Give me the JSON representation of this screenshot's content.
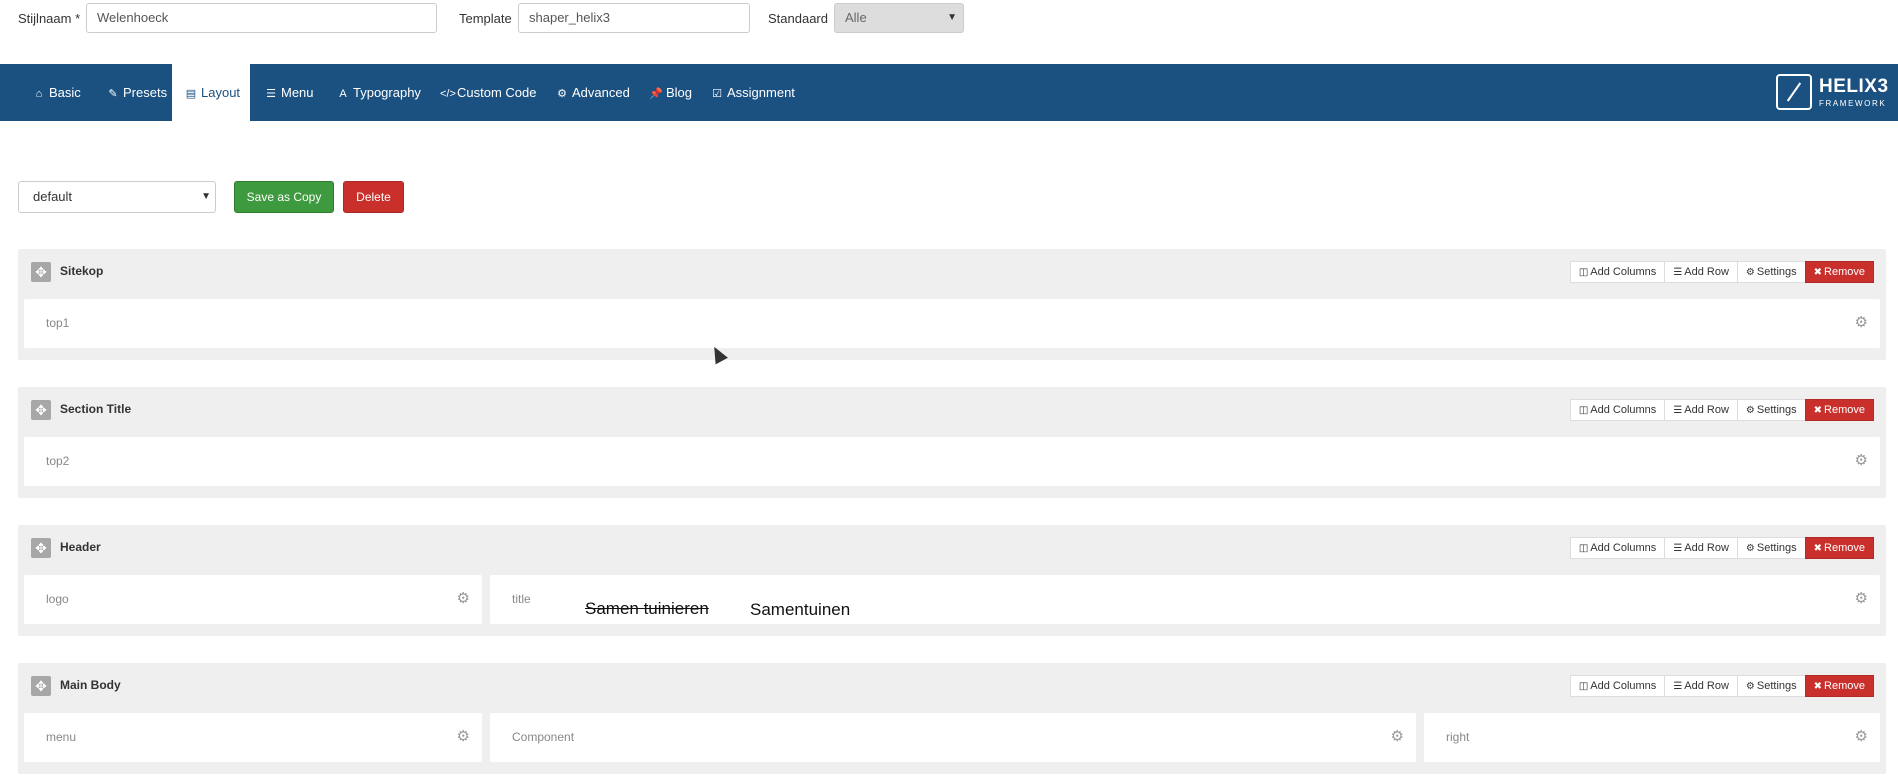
{
  "form": {
    "style_name_label": "Stijlnaam *",
    "style_name_value": "Welenhoeck",
    "template_label": "Template",
    "template_value": "shaper_helix3",
    "default_label": "Standaard",
    "default_value": "Alle"
  },
  "nav": {
    "tabs": [
      {
        "label": "Basic",
        "icon": "home-icon"
      },
      {
        "label": "Presets",
        "icon": "brush-icon"
      },
      {
        "label": "Layout",
        "icon": "layout-icon"
      },
      {
        "label": "Menu",
        "icon": "list-icon"
      },
      {
        "label": "Typography",
        "icon": "font-icon"
      },
      {
        "label": "Custom Code",
        "icon": "code-icon"
      },
      {
        "label": "Advanced",
        "icon": "gear-icon"
      },
      {
        "label": "Blog",
        "icon": "pin-icon"
      },
      {
        "label": "Assignment",
        "icon": "check-square-icon"
      }
    ],
    "active_tab": "Layout",
    "logo_title": "HELIX3",
    "logo_subtitle": "FRAMEWORK"
  },
  "layout_toolbar": {
    "selected_layout": "default",
    "save_copy_label": "Save as Copy",
    "delete_label": "Delete"
  },
  "row_tools": {
    "add_columns": "Add Columns",
    "add_row": "Add Row",
    "settings": "Settings",
    "remove": "Remove"
  },
  "sections": [
    {
      "title": "Sitekop",
      "columns": [
        "top1"
      ]
    },
    {
      "title": "Section Title",
      "columns": [
        "top2"
      ]
    },
    {
      "title": "Header",
      "columns": [
        "logo",
        "title"
      ]
    },
    {
      "title": "Main Body",
      "columns": [
        "menu",
        "Component",
        "right"
      ]
    }
  ],
  "annotations": {
    "struck_text": "Samen tuinieren",
    "replacement_text": "Samentuinen"
  },
  "colors": {
    "nav_bg": "#1b5180",
    "green": "#3e9a3e",
    "red": "#c9302c",
    "section_bg": "#efefef"
  }
}
